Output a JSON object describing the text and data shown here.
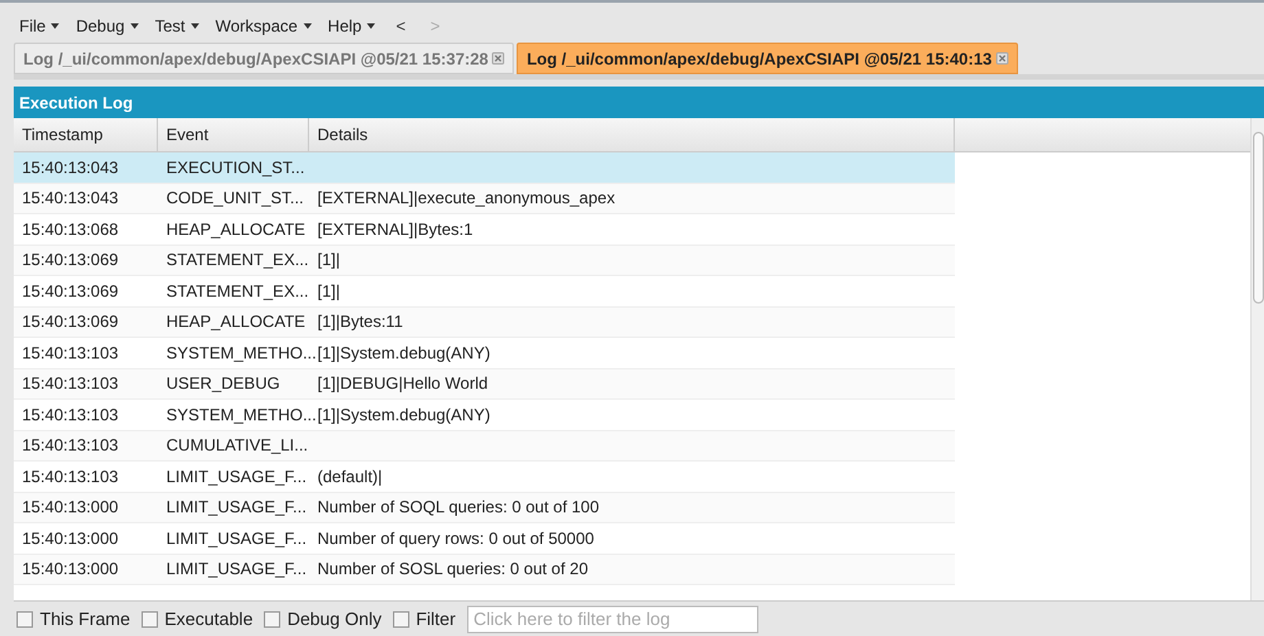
{
  "menu": [
    {
      "label": "File"
    },
    {
      "label": "Debug"
    },
    {
      "label": "Test"
    },
    {
      "label": "Workspace"
    },
    {
      "label": "Help"
    }
  ],
  "nav": [
    {
      "label": "<",
      "disabled": false
    },
    {
      "label": ">",
      "disabled": true
    }
  ],
  "tabs": [
    {
      "label": "Log /_ui/common/apex/debug/ApexCSIAPI @05/21 15:37:28",
      "selected": false
    },
    {
      "label": "Log /_ui/common/apex/debug/ApexCSIAPI @05/21 15:40:13",
      "selected": true
    }
  ],
  "panel": {
    "title": "Execution Log"
  },
  "table": {
    "columns": [
      "Timestamp",
      "Event",
      "Details"
    ],
    "rows": [
      {
        "cells": [
          "15:40:13:043",
          "EXECUTION_ST...",
          ""
        ],
        "selected": true
      },
      {
        "cells": [
          "15:40:13:043",
          "CODE_UNIT_ST...",
          "[EXTERNAL]|execute_anonymous_apex"
        ],
        "selected": false
      },
      {
        "cells": [
          "15:40:13:068",
          "HEAP_ALLOCATE",
          "[EXTERNAL]|Bytes:1"
        ],
        "selected": false
      },
      {
        "cells": [
          "15:40:13:069",
          "STATEMENT_EX...",
          "[1]|"
        ],
        "selected": false
      },
      {
        "cells": [
          "15:40:13:069",
          "STATEMENT_EX...",
          "[1]|"
        ],
        "selected": false
      },
      {
        "cells": [
          "15:40:13:069",
          "HEAP_ALLOCATE",
          "[1]|Bytes:11"
        ],
        "selected": false
      },
      {
        "cells": [
          "15:40:13:103",
          "SYSTEM_METHO...",
          "[1]|System.debug(ANY)"
        ],
        "selected": false
      },
      {
        "cells": [
          "15:40:13:103",
          "USER_DEBUG",
          "[1]|DEBUG|Hello World"
        ],
        "selected": false
      },
      {
        "cells": [
          "15:40:13:103",
          "SYSTEM_METHO...",
          "[1]|System.debug(ANY)"
        ],
        "selected": false
      },
      {
        "cells": [
          "15:40:13:103",
          "CUMULATIVE_LI...",
          ""
        ],
        "selected": false
      },
      {
        "cells": [
          "15:40:13:103",
          "LIMIT_USAGE_F...",
          "(default)|"
        ],
        "selected": false
      },
      {
        "cells": [
          "15:40:13:000",
          "LIMIT_USAGE_F...",
          "Number of SOQL queries: 0 out of 100"
        ],
        "selected": false
      },
      {
        "cells": [
          "15:40:13:000",
          "LIMIT_USAGE_F...",
          "Number of query rows: 0 out of 50000"
        ],
        "selected": false
      },
      {
        "cells": [
          "15:40:13:000",
          "LIMIT_USAGE_F...",
          "Number of SOSL queries: 0 out of 20"
        ],
        "selected": false
      }
    ]
  },
  "filters": [
    {
      "label": "This Frame",
      "checked": false
    },
    {
      "label": "Executable",
      "checked": false
    },
    {
      "label": "Debug Only",
      "checked": false
    },
    {
      "label": "Filter",
      "checked": false
    }
  ],
  "filter_field": {
    "placeholder": "Click here to filter the log"
  }
}
